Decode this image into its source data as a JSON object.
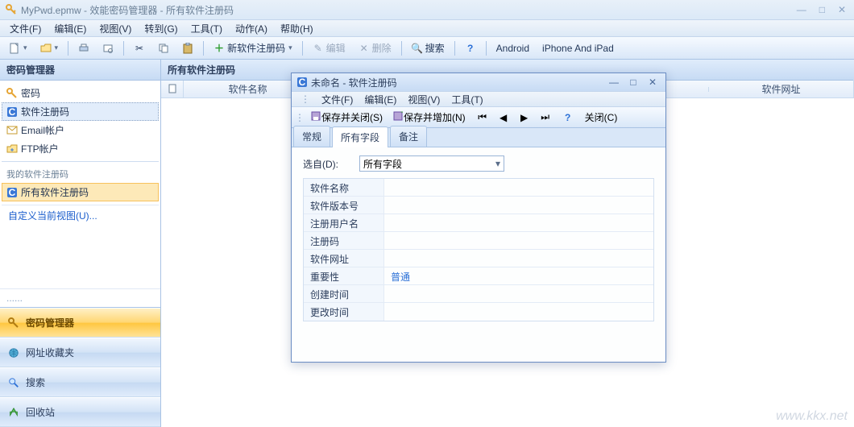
{
  "window": {
    "title": "MyPwd.epmw - 效能密码管理器 - 所有软件注册码"
  },
  "menubar": [
    "文件(F)",
    "编辑(E)",
    "视图(V)",
    "转到(G)",
    "工具(T)",
    "动作(A)",
    "帮助(H)"
  ],
  "toolbar": {
    "new_code": "新软件注册码",
    "edit": "编辑",
    "delete": "删除",
    "search": "搜索",
    "android": "Android",
    "iphone": "iPhone And iPad"
  },
  "sidebar": {
    "header": "密码管理器",
    "items": [
      {
        "icon": "key",
        "label": "密码"
      },
      {
        "icon": "c",
        "label": "软件注册码"
      },
      {
        "icon": "mail",
        "label": "Email帐户"
      },
      {
        "icon": "ftp",
        "label": "FTP帐户"
      }
    ],
    "sub_header": "我的软件注册码",
    "sub_items": [
      {
        "icon": "c",
        "label": "所有软件注册码"
      }
    ],
    "custom_view": "自定义当前视图(U)...",
    "dots": "......"
  },
  "accordion": [
    {
      "icon": "key",
      "label": "密码管理器",
      "active": true
    },
    {
      "icon": "globe",
      "label": "网址收藏夹",
      "active": false
    },
    {
      "icon": "search",
      "label": "搜索",
      "active": false
    },
    {
      "icon": "recycle",
      "label": "回收站",
      "active": false
    }
  ],
  "content": {
    "header": "所有软件注册码",
    "columns": {
      "c0": "",
      "c1": "软件名称",
      "c2": "软件网址"
    }
  },
  "dialog": {
    "title": "未命名 - 软件注册码",
    "menubar": [
      "文件(F)",
      "编辑(E)",
      "视图(V)",
      "工具(T)"
    ],
    "toolbar": {
      "save_close": "保存并关闭(S)",
      "save_add": "保存并增加(N)",
      "close": "关闭(C)"
    },
    "tabs": [
      "常规",
      "所有字段",
      "备注"
    ],
    "active_tab": 1,
    "select_label": "选自(D):",
    "select_value": "所有字段",
    "fields": [
      {
        "label": "软件名称",
        "value": ""
      },
      {
        "label": "软件版本号",
        "value": ""
      },
      {
        "label": "注册用户名",
        "value": ""
      },
      {
        "label": "注册码",
        "value": ""
      },
      {
        "label": "软件网址",
        "value": ""
      },
      {
        "label": "重要性",
        "value": "普通"
      },
      {
        "label": "创建时间",
        "value": ""
      },
      {
        "label": "更改时间",
        "value": ""
      }
    ]
  },
  "watermark": "www.kkx.net"
}
